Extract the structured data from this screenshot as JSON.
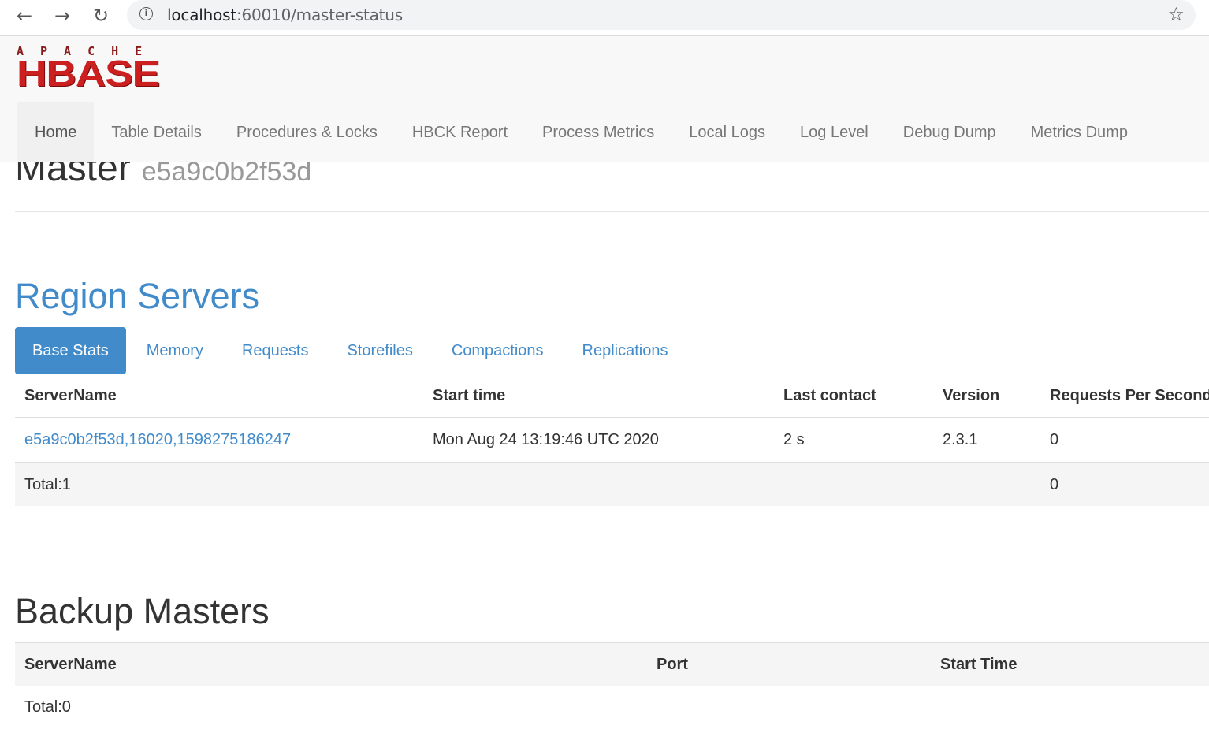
{
  "browser": {
    "url_host": "localhost",
    "url_rest": ":60010/master-status"
  },
  "header": {
    "logo_top": "APACHE",
    "logo_main": "HBASE",
    "nav": [
      {
        "label": "Home"
      },
      {
        "label": "Table Details"
      },
      {
        "label": "Procedures & Locks"
      },
      {
        "label": "HBCK Report"
      },
      {
        "label": "Process Metrics"
      },
      {
        "label": "Local Logs"
      },
      {
        "label": "Log Level"
      },
      {
        "label": "Debug Dump"
      },
      {
        "label": "Metrics Dump"
      }
    ]
  },
  "master": {
    "title": "Master",
    "host": "e5a9c0b2f53d"
  },
  "region_servers": {
    "title": "Region Servers",
    "tabs": [
      "Base Stats",
      "Memory",
      "Requests",
      "Storefiles",
      "Compactions",
      "Replications"
    ],
    "columns": [
      "ServerName",
      "Start time",
      "Last contact",
      "Version",
      "Requests Per Second"
    ],
    "rows": [
      {
        "server": "e5a9c0b2f53d,16020,1598275186247",
        "start": "Mon Aug 24 13:19:46 UTC 2020",
        "last_contact": "2 s",
        "version": "2.3.1",
        "rps": "0"
      }
    ],
    "total_label": "Total:1",
    "total_rps": "0"
  },
  "backup_masters": {
    "title": "Backup Masters",
    "columns": [
      "ServerName",
      "Port",
      "Start Time"
    ],
    "total_label": "Total:0"
  },
  "colors": {
    "link": "#428bca",
    "logo_red": "#cc1f1f"
  }
}
